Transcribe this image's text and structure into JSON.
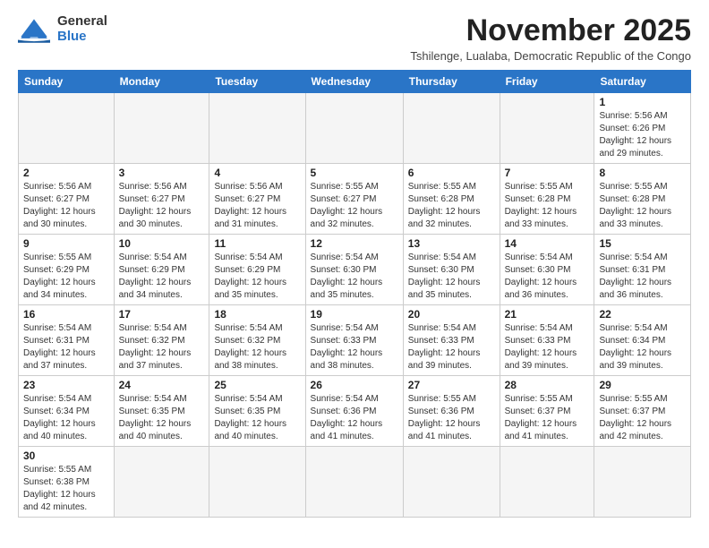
{
  "logo": {
    "line1": "General",
    "line2": "Blue"
  },
  "header": {
    "month_title": "November 2025",
    "subtitle": "Tshilenge, Lualaba, Democratic Republic of the Congo"
  },
  "weekdays": [
    "Sunday",
    "Monday",
    "Tuesday",
    "Wednesday",
    "Thursday",
    "Friday",
    "Saturday"
  ],
  "weeks": [
    [
      {
        "day": "",
        "info": ""
      },
      {
        "day": "",
        "info": ""
      },
      {
        "day": "",
        "info": ""
      },
      {
        "day": "",
        "info": ""
      },
      {
        "day": "",
        "info": ""
      },
      {
        "day": "",
        "info": ""
      },
      {
        "day": "1",
        "info": "Sunrise: 5:56 AM\nSunset: 6:26 PM\nDaylight: 12 hours and 29 minutes."
      }
    ],
    [
      {
        "day": "2",
        "info": "Sunrise: 5:56 AM\nSunset: 6:27 PM\nDaylight: 12 hours and 30 minutes."
      },
      {
        "day": "3",
        "info": "Sunrise: 5:56 AM\nSunset: 6:27 PM\nDaylight: 12 hours and 30 minutes."
      },
      {
        "day": "4",
        "info": "Sunrise: 5:56 AM\nSunset: 6:27 PM\nDaylight: 12 hours and 31 minutes."
      },
      {
        "day": "5",
        "info": "Sunrise: 5:55 AM\nSunset: 6:27 PM\nDaylight: 12 hours and 32 minutes."
      },
      {
        "day": "6",
        "info": "Sunrise: 5:55 AM\nSunset: 6:28 PM\nDaylight: 12 hours and 32 minutes."
      },
      {
        "day": "7",
        "info": "Sunrise: 5:55 AM\nSunset: 6:28 PM\nDaylight: 12 hours and 33 minutes."
      },
      {
        "day": "8",
        "info": "Sunrise: 5:55 AM\nSunset: 6:28 PM\nDaylight: 12 hours and 33 minutes."
      }
    ],
    [
      {
        "day": "9",
        "info": "Sunrise: 5:55 AM\nSunset: 6:29 PM\nDaylight: 12 hours and 34 minutes."
      },
      {
        "day": "10",
        "info": "Sunrise: 5:54 AM\nSunset: 6:29 PM\nDaylight: 12 hours and 34 minutes."
      },
      {
        "day": "11",
        "info": "Sunrise: 5:54 AM\nSunset: 6:29 PM\nDaylight: 12 hours and 35 minutes."
      },
      {
        "day": "12",
        "info": "Sunrise: 5:54 AM\nSunset: 6:30 PM\nDaylight: 12 hours and 35 minutes."
      },
      {
        "day": "13",
        "info": "Sunrise: 5:54 AM\nSunset: 6:30 PM\nDaylight: 12 hours and 35 minutes."
      },
      {
        "day": "14",
        "info": "Sunrise: 5:54 AM\nSunset: 6:30 PM\nDaylight: 12 hours and 36 minutes."
      },
      {
        "day": "15",
        "info": "Sunrise: 5:54 AM\nSunset: 6:31 PM\nDaylight: 12 hours and 36 minutes."
      }
    ],
    [
      {
        "day": "16",
        "info": "Sunrise: 5:54 AM\nSunset: 6:31 PM\nDaylight: 12 hours and 37 minutes."
      },
      {
        "day": "17",
        "info": "Sunrise: 5:54 AM\nSunset: 6:32 PM\nDaylight: 12 hours and 37 minutes."
      },
      {
        "day": "18",
        "info": "Sunrise: 5:54 AM\nSunset: 6:32 PM\nDaylight: 12 hours and 38 minutes."
      },
      {
        "day": "19",
        "info": "Sunrise: 5:54 AM\nSunset: 6:33 PM\nDaylight: 12 hours and 38 minutes."
      },
      {
        "day": "20",
        "info": "Sunrise: 5:54 AM\nSunset: 6:33 PM\nDaylight: 12 hours and 39 minutes."
      },
      {
        "day": "21",
        "info": "Sunrise: 5:54 AM\nSunset: 6:33 PM\nDaylight: 12 hours and 39 minutes."
      },
      {
        "day": "22",
        "info": "Sunrise: 5:54 AM\nSunset: 6:34 PM\nDaylight: 12 hours and 39 minutes."
      }
    ],
    [
      {
        "day": "23",
        "info": "Sunrise: 5:54 AM\nSunset: 6:34 PM\nDaylight: 12 hours and 40 minutes."
      },
      {
        "day": "24",
        "info": "Sunrise: 5:54 AM\nSunset: 6:35 PM\nDaylight: 12 hours and 40 minutes."
      },
      {
        "day": "25",
        "info": "Sunrise: 5:54 AM\nSunset: 6:35 PM\nDaylight: 12 hours and 40 minutes."
      },
      {
        "day": "26",
        "info": "Sunrise: 5:54 AM\nSunset: 6:36 PM\nDaylight: 12 hours and 41 minutes."
      },
      {
        "day": "27",
        "info": "Sunrise: 5:55 AM\nSunset: 6:36 PM\nDaylight: 12 hours and 41 minutes."
      },
      {
        "day": "28",
        "info": "Sunrise: 5:55 AM\nSunset: 6:37 PM\nDaylight: 12 hours and 41 minutes."
      },
      {
        "day": "29",
        "info": "Sunrise: 5:55 AM\nSunset: 6:37 PM\nDaylight: 12 hours and 42 minutes."
      }
    ],
    [
      {
        "day": "30",
        "info": "Sunrise: 5:55 AM\nSunset: 6:38 PM\nDaylight: 12 hours and 42 minutes."
      },
      {
        "day": "",
        "info": ""
      },
      {
        "day": "",
        "info": ""
      },
      {
        "day": "",
        "info": ""
      },
      {
        "day": "",
        "info": ""
      },
      {
        "day": "",
        "info": ""
      },
      {
        "day": "",
        "info": ""
      }
    ]
  ]
}
